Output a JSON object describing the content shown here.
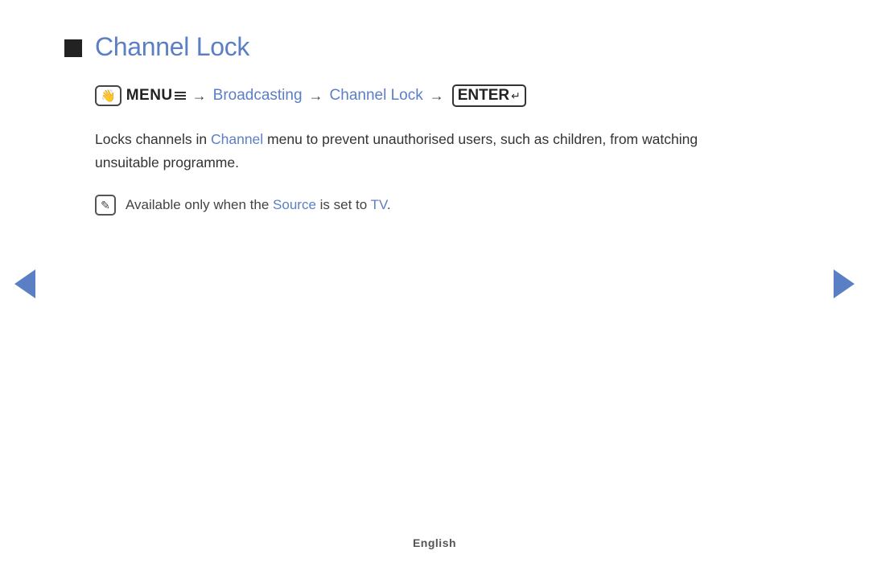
{
  "header": {
    "title": "Channel Lock",
    "title_icon": "■"
  },
  "breadcrumb": {
    "menu_label": "MENU",
    "arrow1": "→",
    "broadcasting": "Broadcasting",
    "arrow2": "→",
    "channel_lock": "Channel Lock",
    "arrow3": "→",
    "enter_label": "ENTER"
  },
  "description": {
    "text_before": "Locks channels in ",
    "channel_link": "Channel",
    "text_after": " menu to prevent unauthorised users, such as children, from watching unsuitable programme."
  },
  "note": {
    "text_before": "Available only when the ",
    "source_link": "Source",
    "text_middle": " is set to ",
    "tv_link": "TV",
    "text_end": "."
  },
  "navigation": {
    "left_label": "◄",
    "right_label": "►"
  },
  "footer": {
    "language": "English"
  }
}
